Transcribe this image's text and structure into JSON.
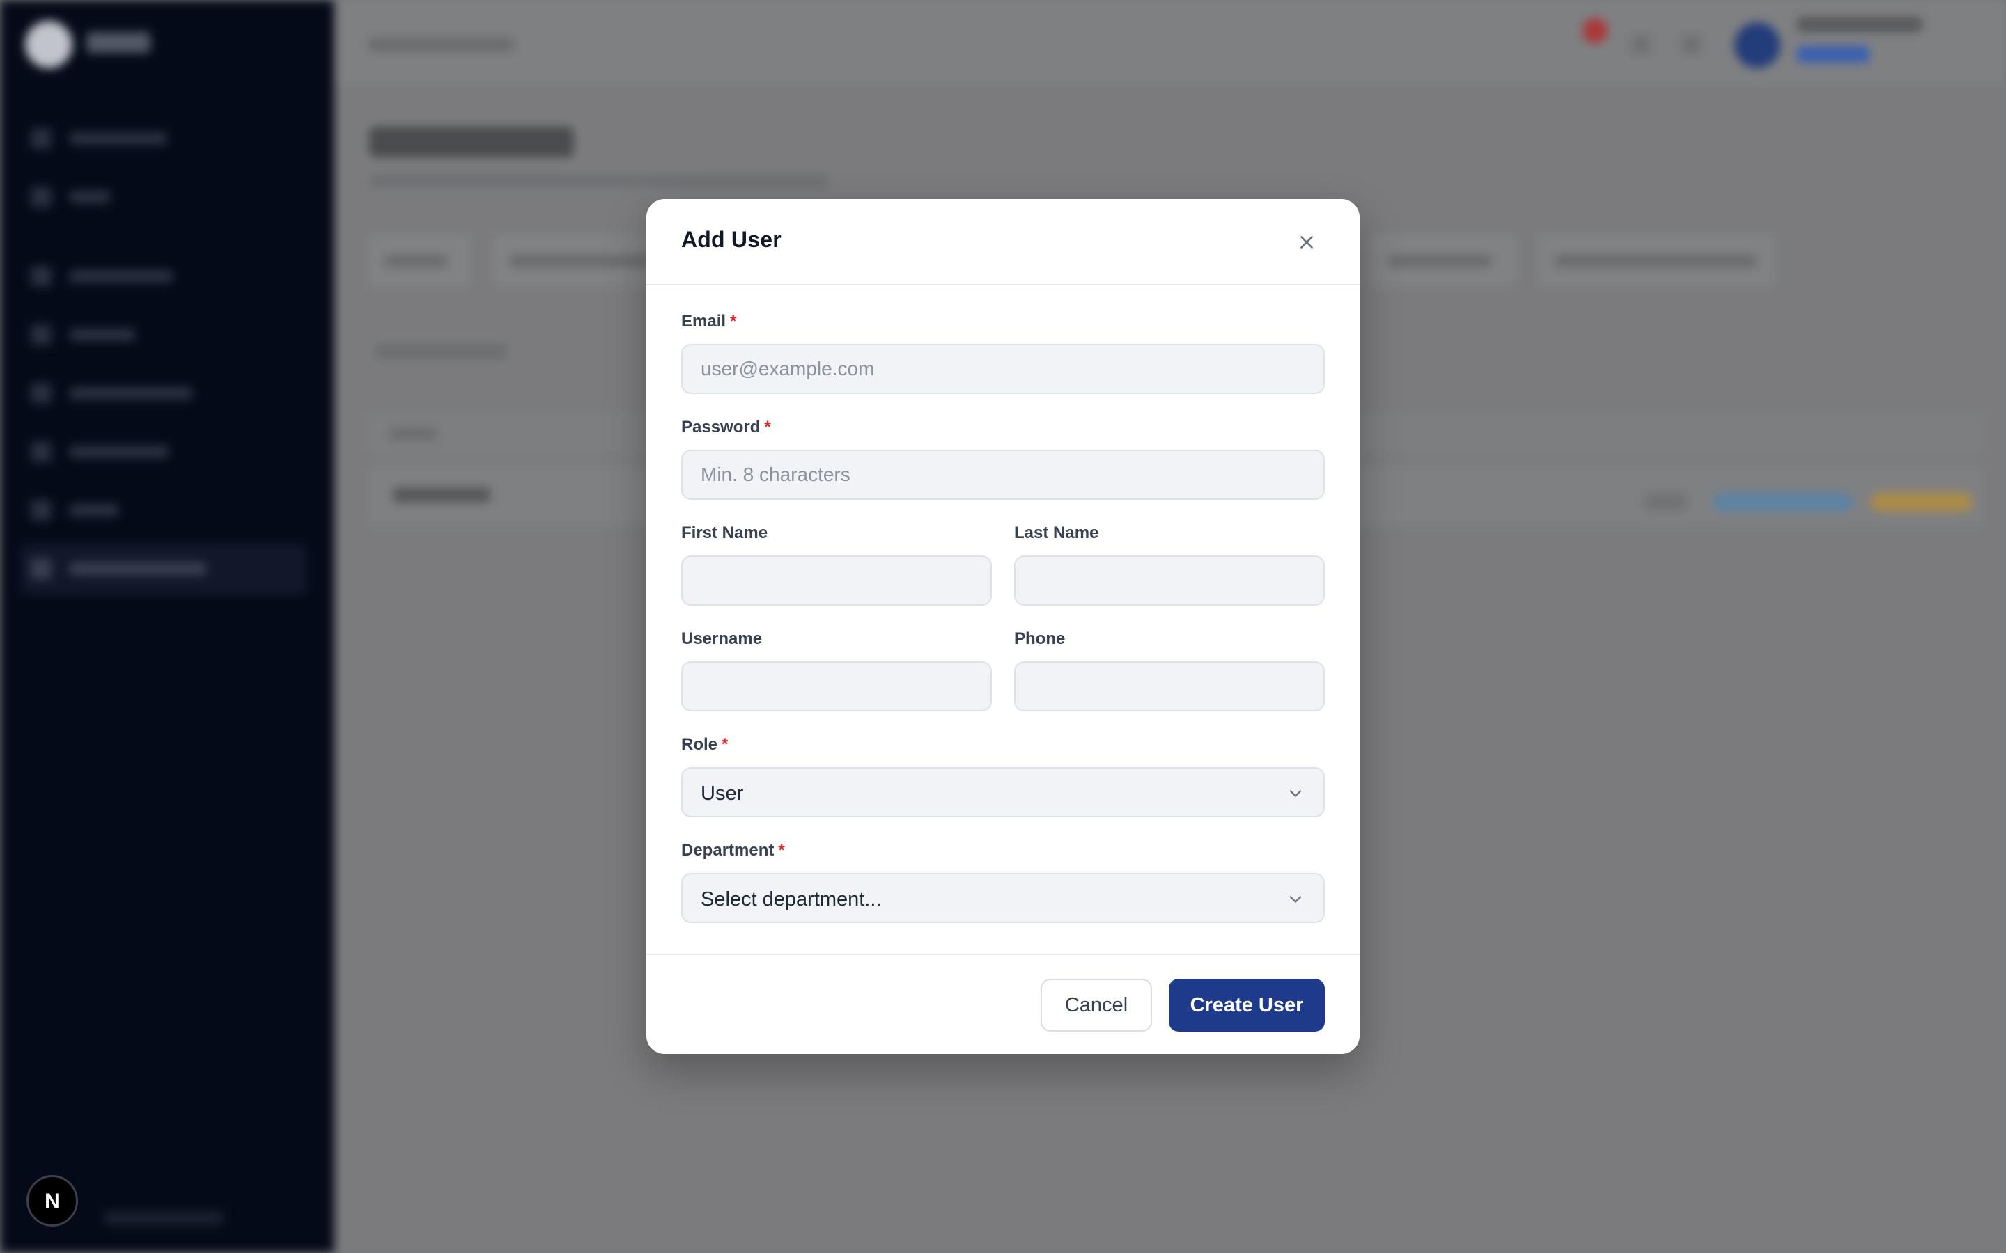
{
  "modal": {
    "title": "Add User",
    "fields": {
      "email": {
        "label": "Email",
        "required_mark": "*",
        "placeholder": "user@example.com",
        "value": ""
      },
      "password": {
        "label": "Password",
        "required_mark": "*",
        "placeholder": "Min. 8 characters",
        "value": ""
      },
      "first_name": {
        "label": "First Name",
        "placeholder": "",
        "value": ""
      },
      "last_name": {
        "label": "Last Name",
        "placeholder": "",
        "value": ""
      },
      "username": {
        "label": "Username",
        "placeholder": "",
        "value": ""
      },
      "phone": {
        "label": "Phone",
        "placeholder": "",
        "value": ""
      },
      "role": {
        "label": "Role",
        "required_mark": "*",
        "selected": "User"
      },
      "department": {
        "label": "Department",
        "required_mark": "*",
        "selected": "Select department..."
      }
    },
    "buttons": {
      "cancel": "Cancel",
      "create": "Create User"
    }
  },
  "badge": {
    "letter": "N"
  },
  "icons": {
    "close": "close-icon",
    "chevron": "chevron-down-icon",
    "nextjs": "nextjs-logo-icon"
  },
  "colors": {
    "primary_button": "#1e3a8a",
    "required": "#dc2626",
    "sidebar": "#050b1a",
    "input_bg": "#f1f3f7"
  }
}
